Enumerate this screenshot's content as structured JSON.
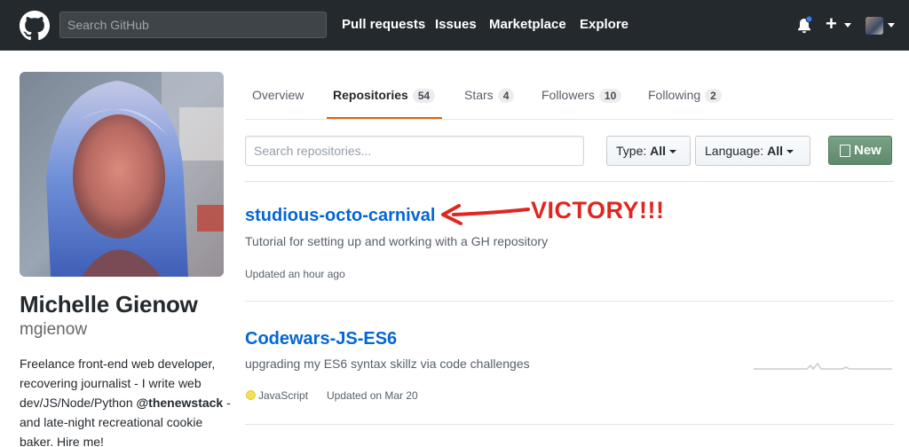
{
  "header": {
    "search_placeholder": "Search GitHub",
    "nav": [
      "Pull requests",
      "Issues",
      "Marketplace",
      "Explore"
    ],
    "icons": [
      "github-logo",
      "bell-icon",
      "plus-icon",
      "avatar"
    ]
  },
  "profile": {
    "name": "Michelle Gienow",
    "username": "mgienow",
    "bio_before": "Freelance front-end web developer, recovering journalist - I write web dev/JS/Node/Python ",
    "bio_handle": "@thenewstack",
    "bio_after": " - and late-night recreational cookie baker. Hire me!"
  },
  "tabs": [
    {
      "label": "Overview",
      "count": null
    },
    {
      "label": "Repositories",
      "count": "54"
    },
    {
      "label": "Stars",
      "count": "4"
    },
    {
      "label": "Followers",
      "count": "10"
    },
    {
      "label": "Following",
      "count": "2"
    }
  ],
  "filters": {
    "search_placeholder": "Search repositories...",
    "type_label": "Type:",
    "type_value": "All",
    "language_label": "Language:",
    "language_value": "All",
    "new_label": "New"
  },
  "repos": [
    {
      "name": "studious-octo-carnival",
      "description": "Tutorial for setting up and working with a GH repository",
      "updated": "Updated an hour ago"
    },
    {
      "name": "Codewars-JS-ES6",
      "description": "upgrading my ES6 syntax skillz via code challenges",
      "language": "JavaScript",
      "language_color": "#f1e05a",
      "updated": "Updated on Mar 20"
    }
  ],
  "annotation": {
    "text": "VICTORY!!!",
    "color": "#e0261f"
  },
  "colors": {
    "header_bg": "#24292e",
    "link": "#0366d6",
    "tab_accent": "#e36209",
    "new_button": "#6c9577"
  }
}
